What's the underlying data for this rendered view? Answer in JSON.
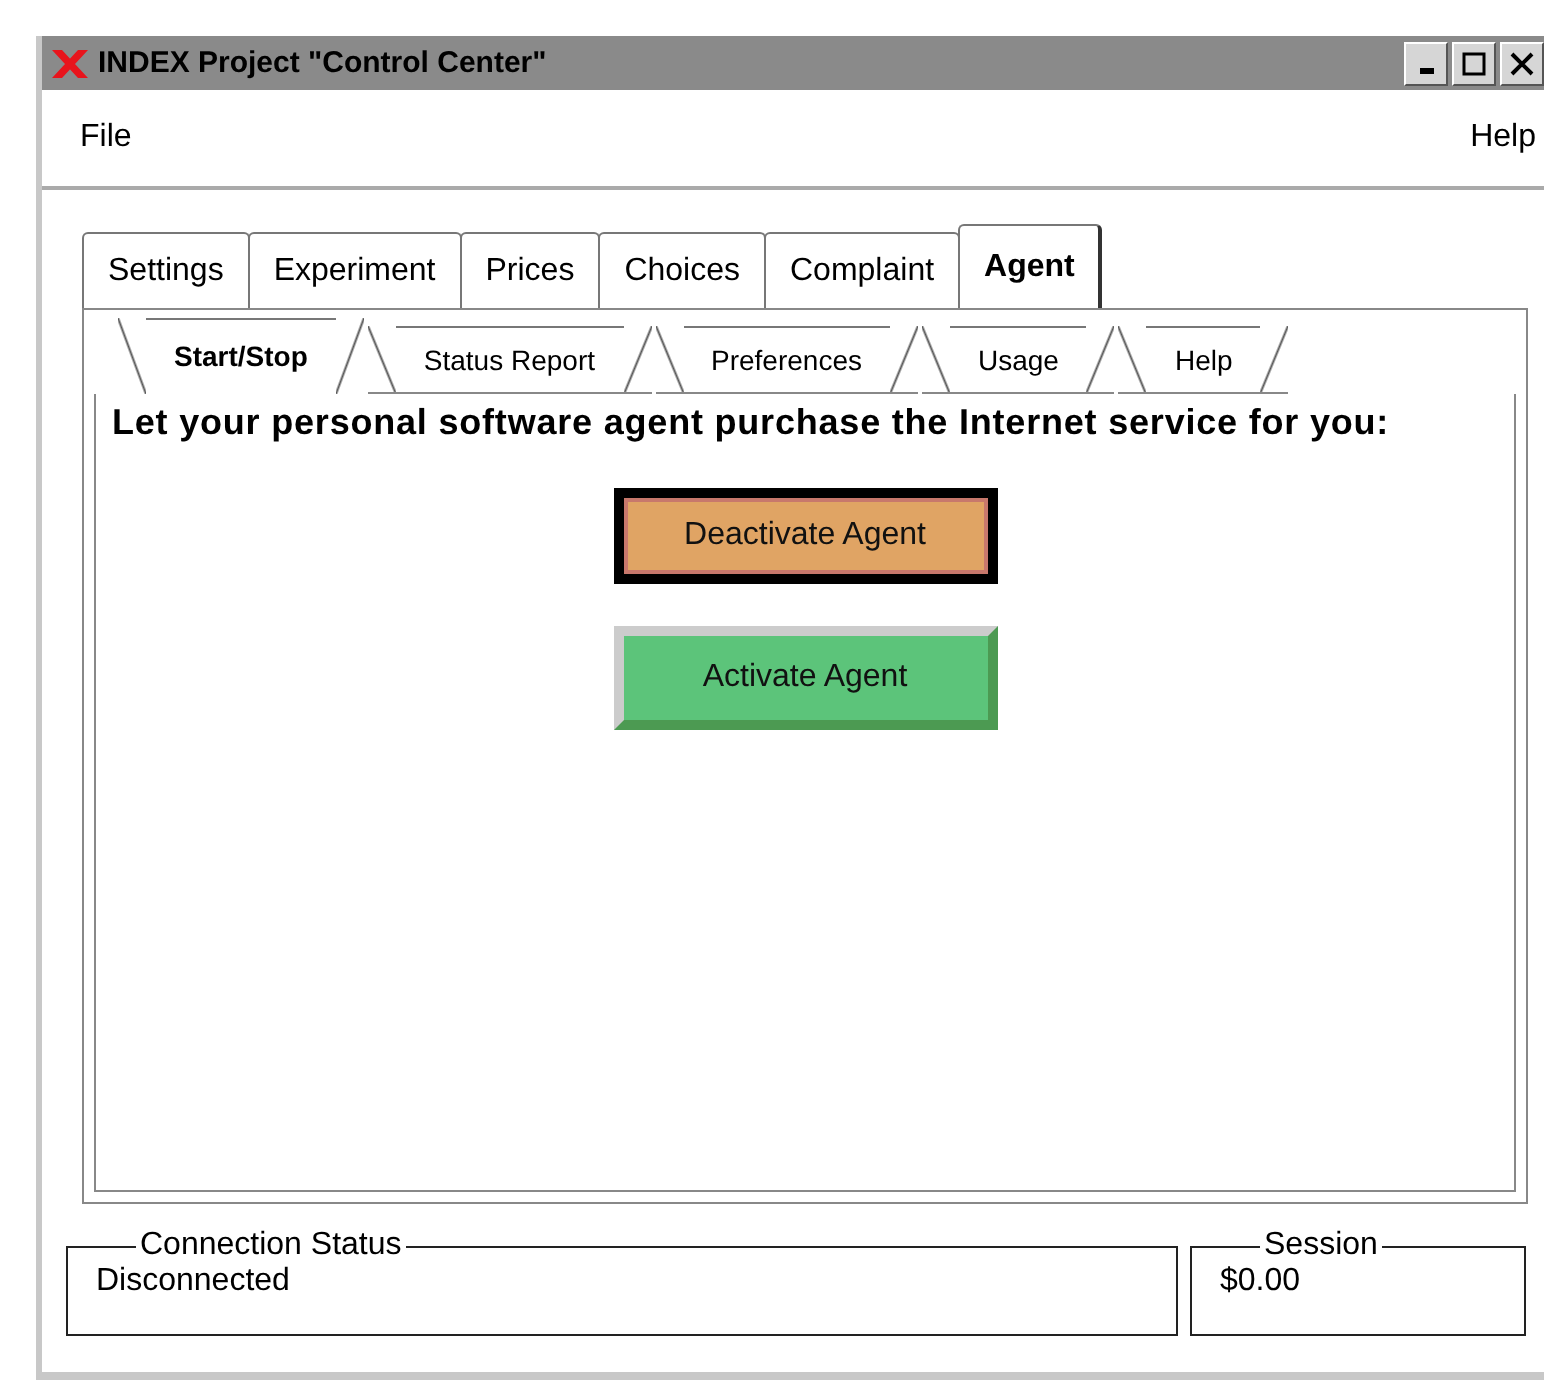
{
  "window": {
    "title": "INDEX Project \"Control Center\""
  },
  "menu": [
    "File",
    "Help"
  ],
  "tabs": [
    {
      "label": "Settings",
      "selected": false
    },
    {
      "label": "Experiment",
      "selected": false
    },
    {
      "label": "Prices",
      "selected": false
    },
    {
      "label": "Choices",
      "selected": false
    },
    {
      "label": "Complaint",
      "selected": false
    },
    {
      "label": "Agent",
      "selected": true
    }
  ],
  "subtabs": [
    {
      "label": "Start/Stop",
      "selected": true
    },
    {
      "label": "Status Report",
      "selected": false
    },
    {
      "label": "Preferences",
      "selected": false
    },
    {
      "label": "Usage",
      "selected": false
    },
    {
      "label": "Help",
      "selected": false
    }
  ],
  "prompt": "Let your personal software agent purchase the Internet service for you:",
  "buttons": [
    {
      "label": "Deactivate Agent",
      "kind": "deactivate",
      "focused": true
    },
    {
      "label": "Activate Agent",
      "kind": "activate",
      "focused": false
    }
  ],
  "status": [
    {
      "title": "Connection Status",
      "value": "Disconnected"
    },
    {
      "title": "Session",
      "value": "$0.00"
    }
  ]
}
